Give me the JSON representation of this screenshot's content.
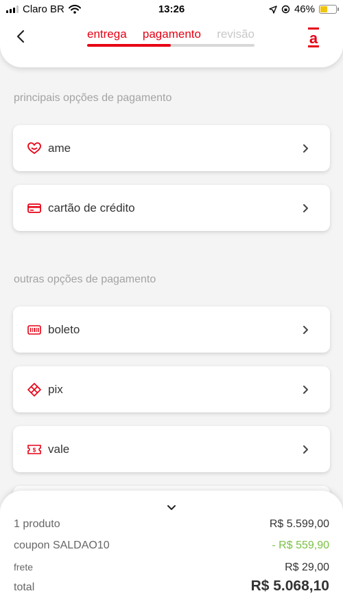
{
  "status_bar": {
    "carrier": "Claro BR",
    "time": "13:26",
    "battery": "46%",
    "battery_level": 0.46
  },
  "header": {
    "steps": [
      {
        "label": "entrega",
        "state": "done"
      },
      {
        "label": "pagamento",
        "state": "current"
      },
      {
        "label": "revisão",
        "state": "pending"
      }
    ],
    "progress_fraction": 0.5,
    "brand_letter": "a"
  },
  "main_options": {
    "title": "principais opções de pagamento",
    "items": [
      {
        "label": "ame",
        "icon": "heart-icon"
      },
      {
        "label": "cartão de crédito",
        "icon": "credit-card-icon"
      }
    ]
  },
  "other_options": {
    "title": "outras opções de pagamento",
    "items": [
      {
        "label": "boleto",
        "icon": "barcode-icon"
      },
      {
        "label": "pix",
        "icon": "pix-icon"
      },
      {
        "label": "vale",
        "icon": "voucher-icon"
      }
    ]
  },
  "summary": {
    "product_label": "1 produto",
    "product_value": "R$ 5.599,00",
    "coupon_label": "coupon SALDAO10",
    "coupon_value": "- R$ 559,90",
    "shipping_label": "frete",
    "shipping_value": "R$ 29,00",
    "total_label": "total",
    "total_value": "R$ 5.068,10"
  },
  "colors": {
    "accent": "#e60014",
    "discount": "#7bc043",
    "muted": "#a3a3a3"
  }
}
